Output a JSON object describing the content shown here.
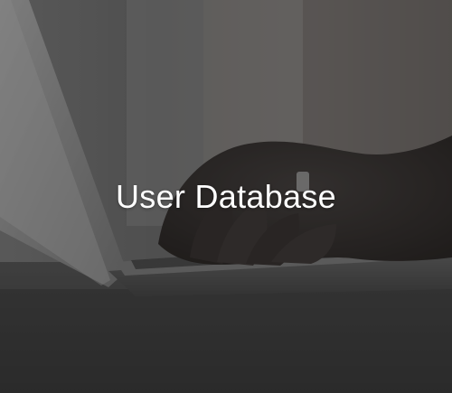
{
  "card": {
    "title": "User Database",
    "background_subject": "laptop-typing-photo",
    "overlay_color": "#141414"
  }
}
